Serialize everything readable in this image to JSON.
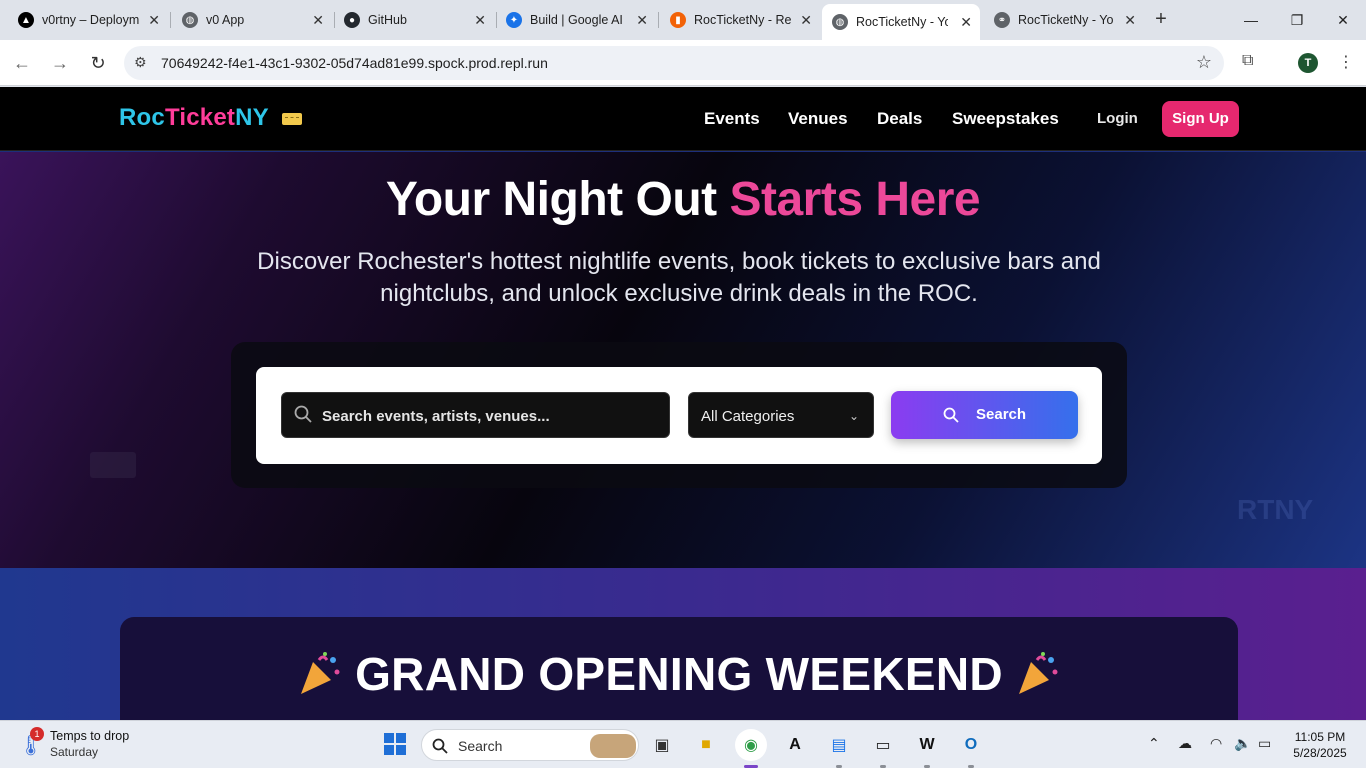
{
  "browser": {
    "tabs": [
      {
        "title": "v0rtny – Deploym",
        "icon": "vercel-icon",
        "active": false
      },
      {
        "title": "v0 App",
        "icon": "globe-icon",
        "active": false
      },
      {
        "title": "GitHub",
        "icon": "github-icon",
        "active": false
      },
      {
        "title": "Build | Google AI",
        "icon": "google-ai-studio-icon",
        "active": false
      },
      {
        "title": "RocTicketNy - Re",
        "icon": "replit-icon",
        "active": false
      },
      {
        "title": "RocTicketNy - Yo",
        "icon": "globe-icon",
        "active": true
      },
      {
        "title": "RocTicketNy - Yo",
        "icon": "link-globe-icon",
        "active": false
      }
    ],
    "url": "70649242-f4e1-43c1-9302-05d74ad81e99.spock.prod.repl.run",
    "profile_initial": "T"
  },
  "site": {
    "logo": {
      "part1": "Roc",
      "part2": "Ticket",
      "part3": "NY"
    },
    "nav": [
      "Events",
      "Venues",
      "Deals",
      "Sweepstakes"
    ],
    "login": "Login",
    "signup": "Sign Up"
  },
  "hero": {
    "title_main": "Your Night Out ",
    "title_accent": "Starts Here",
    "subtitle": "Discover Rochester's hottest nightlife events, book tickets to exclusive bars and nightclubs, and unlock exclusive drink deals in the ROC.",
    "search_placeholder": "Search events, artists, venues...",
    "category_selected": "All Categories",
    "search_button": "Search",
    "watermark": "RTNY"
  },
  "promo": {
    "title": "GRAND OPENING WEEKEND"
  },
  "colors": {
    "brand_cyan": "#2ec5e8",
    "brand_pink": "#ec4899",
    "signup_pink": "#e6286f",
    "search_gradient_start": "#8b3cf0",
    "search_gradient_end": "#3570ec"
  },
  "taskbar": {
    "weather_title": "Temps to drop",
    "weather_sub": "Saturday",
    "weather_badge": "1",
    "search_label": "Search",
    "time": "11:05 PM",
    "date": "5/28/2025"
  }
}
